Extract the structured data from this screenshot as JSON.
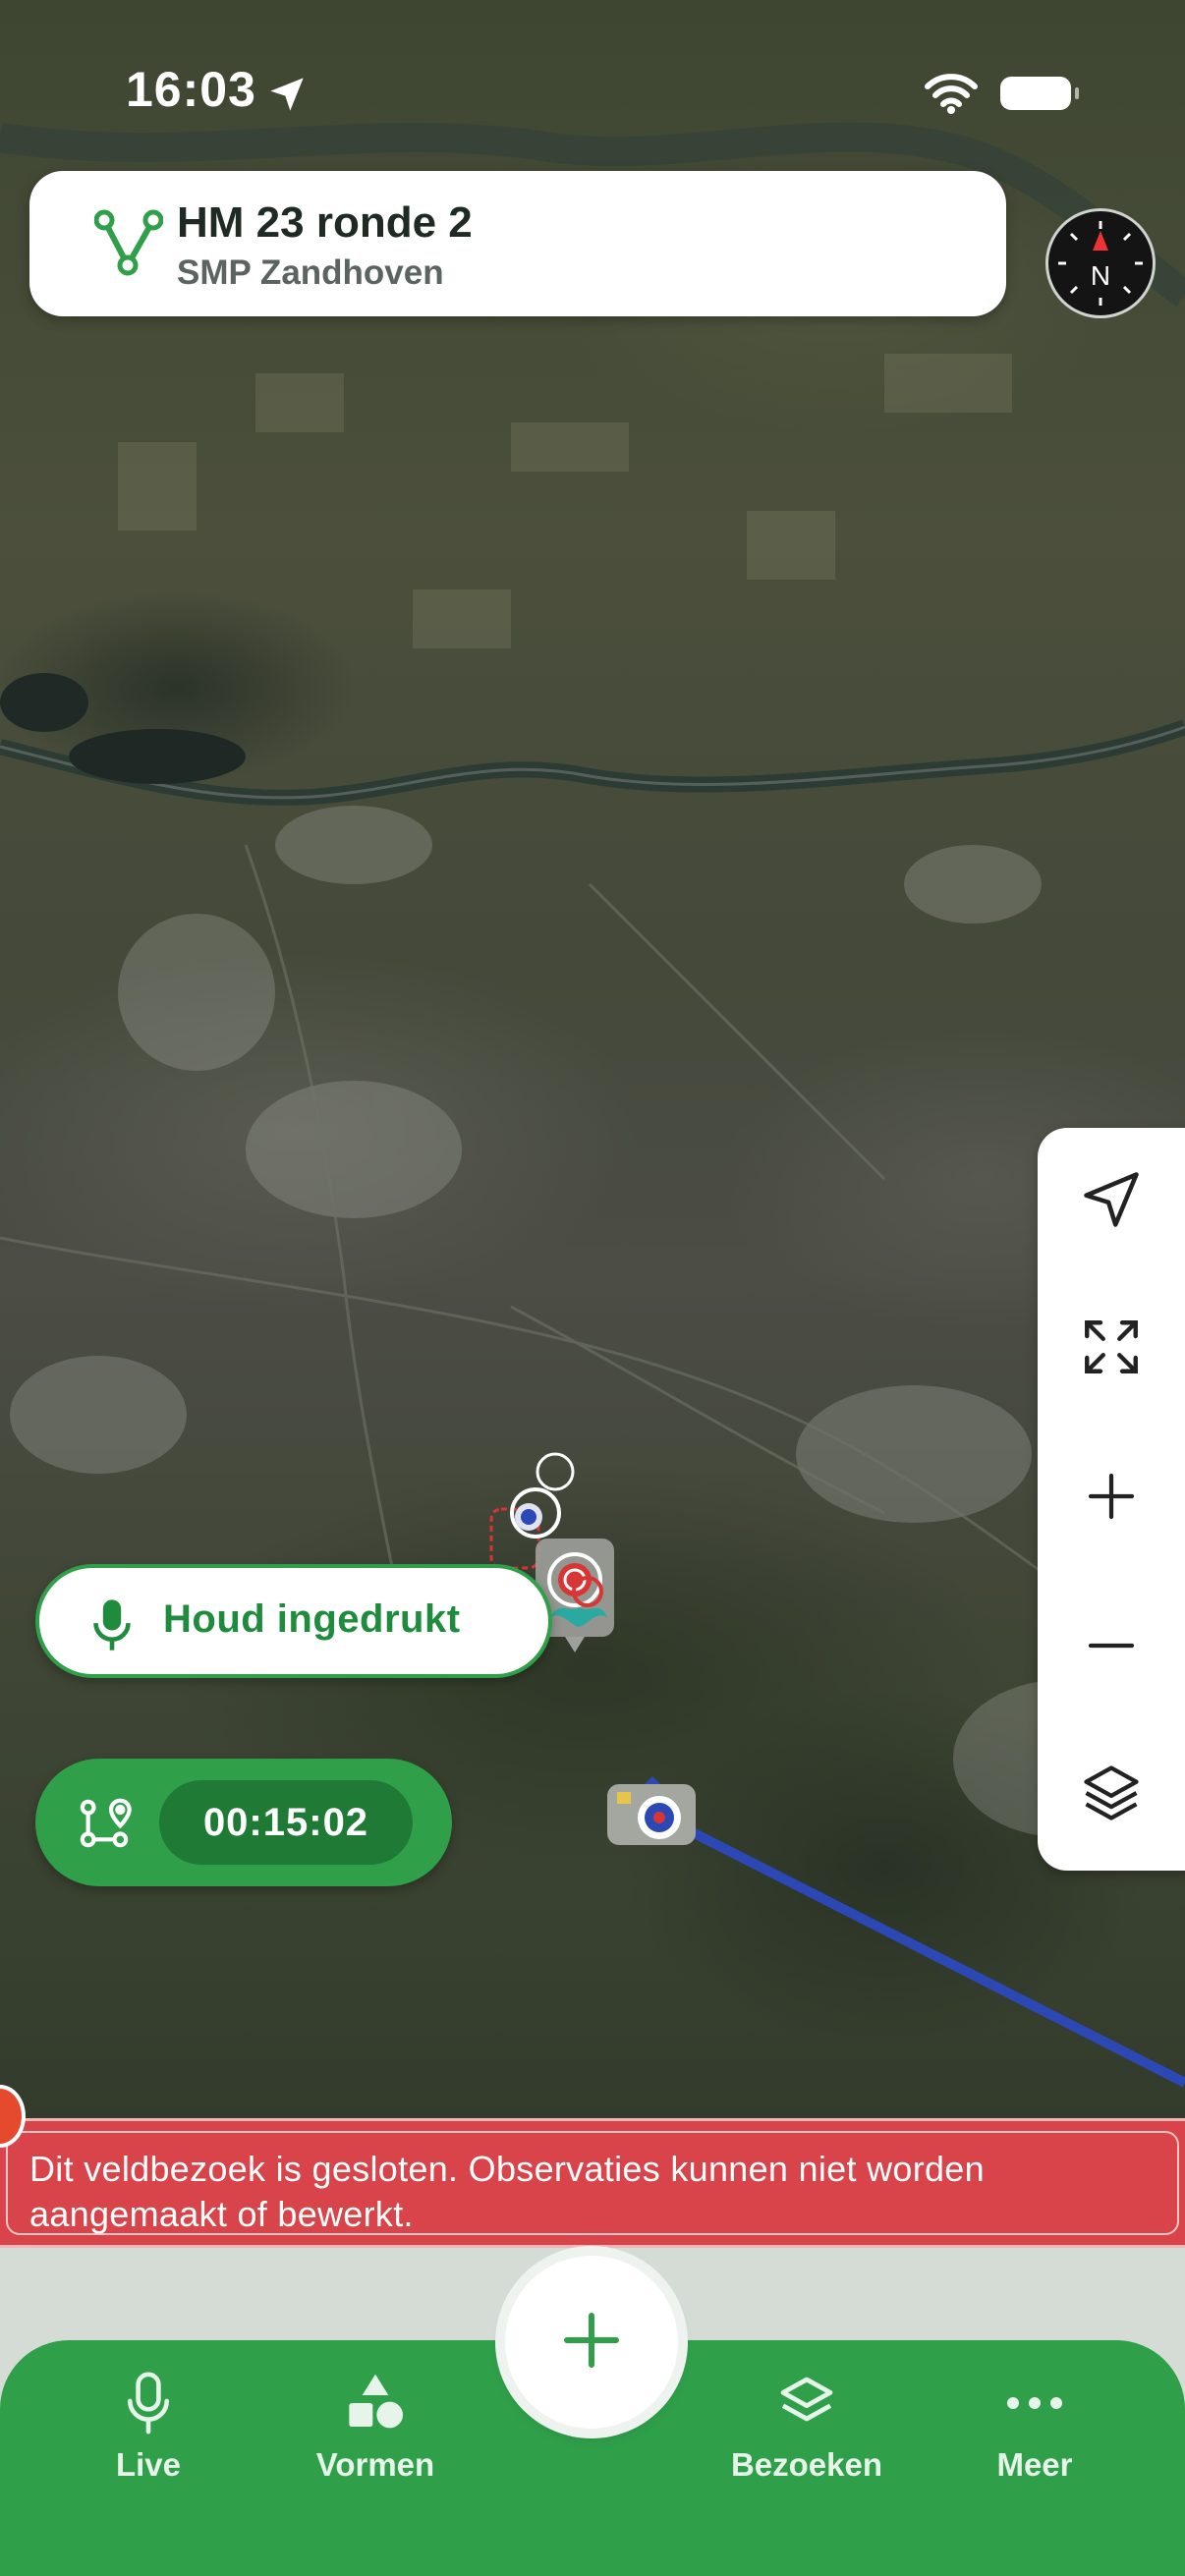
{
  "status_bar": {
    "time": "16:03"
  },
  "header": {
    "title": "HM 23 ronde 2",
    "subtitle": "SMP Zandhoven"
  },
  "compass": {
    "label": "N"
  },
  "voice_button": {
    "label": "Houd ingedrukt"
  },
  "timer": {
    "elapsed": "00:15:02"
  },
  "banner": {
    "message": "Dit veldbezoek is gesloten. Observaties kunnen niet worden aangemaakt of bewerkt."
  },
  "bottom_nav": {
    "items": [
      {
        "label": "Live",
        "icon": "microphone-icon"
      },
      {
        "label": "Vormen",
        "icon": "shapes-icon"
      },
      {
        "label": "Bezoeken",
        "icon": "layers-icon"
      },
      {
        "label": "Meer",
        "icon": "more-dots-icon"
      }
    ],
    "add_icon": "plus-icon"
  },
  "map_controls": [
    "locate-icon",
    "fit-bounds-icon",
    "zoom-in-icon",
    "zoom-out-icon",
    "layers-icon"
  ],
  "colors": {
    "accent": "#2f9f4a",
    "banner": "#d84449",
    "track": "#2b48b5"
  }
}
